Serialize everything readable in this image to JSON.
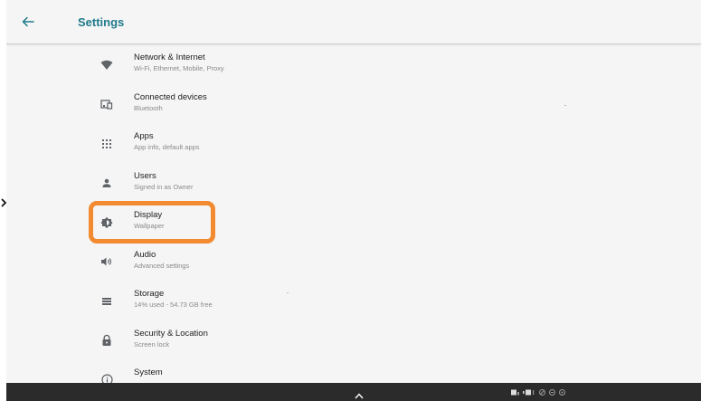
{
  "header": {
    "title": "Settings",
    "back_icon": "arrow-back-icon"
  },
  "colors": {
    "accent": "#1f7a8c",
    "highlight": "#f28a30",
    "background": "#f5f5f5",
    "navbar": "#2b2b2b"
  },
  "settings": {
    "items": [
      {
        "icon": "wifi-icon",
        "title": "Network & Internet",
        "subtitle": "Wi-Fi, Ethernet, Mobile, Proxy"
      },
      {
        "icon": "connected-devices-icon",
        "title": "Connected devices",
        "subtitle": "Bluetooth"
      },
      {
        "icon": "apps-grid-icon",
        "title": "Apps",
        "subtitle": "App info, default apps"
      },
      {
        "icon": "user-icon",
        "title": "Users",
        "subtitle": "Signed in as Owner"
      },
      {
        "icon": "brightness-icon",
        "title": "Display",
        "subtitle": "Wallpaper"
      },
      {
        "icon": "volume-icon",
        "title": "Audio",
        "subtitle": "Advanced settings"
      },
      {
        "icon": "storage-icon",
        "title": "Storage",
        "subtitle": "14% used - 54.73 GB free"
      },
      {
        "icon": "lock-icon",
        "title": "Security & Location",
        "subtitle": "Screen lock"
      },
      {
        "icon": "info-icon",
        "title": "System",
        "subtitle": ""
      }
    ]
  },
  "navbar": {
    "up_icon": "chevron-up-icon",
    "status_icons": [
      "screen-cast-icon",
      "window-icon",
      "circle-icon",
      "circle-icon",
      "circle-icon"
    ]
  }
}
